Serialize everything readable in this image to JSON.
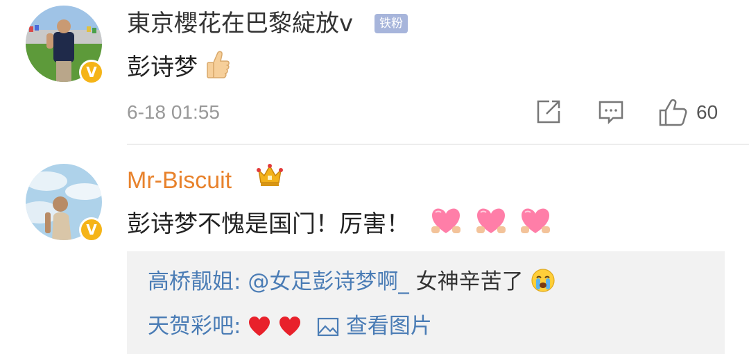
{
  "comments": [
    {
      "username": "東京櫻花在巴黎綻放v",
      "fan_badge": "铁粉",
      "text": "彭诗梦",
      "emoji": "thumbs-up",
      "time": "6-18 01:55",
      "like_count": "60"
    },
    {
      "username": "Mr-Biscuit",
      "text": "彭诗梦不愧是国门！厉害！",
      "emojis": [
        "heart-hands",
        "heart-hands",
        "heart-hands"
      ],
      "replies": [
        {
          "name": "高桥靓姐:",
          "mention": "@女足彭诗梦啊_",
          "text": "女神辛苦了",
          "emoji": "crying-face"
        },
        {
          "name": "天贺彩吧:",
          "emojis": [
            "red-heart",
            "red-heart"
          ],
          "view_image_label": "查看图片"
        }
      ]
    }
  ],
  "verified_badge": "V",
  "colors": {
    "accent_orange": "#e8822c",
    "link_blue": "#4a7cb5",
    "verified_yellow": "#f5b418",
    "fan_badge_bg": "#a7b5db",
    "reply_bg": "#f2f2f2"
  }
}
